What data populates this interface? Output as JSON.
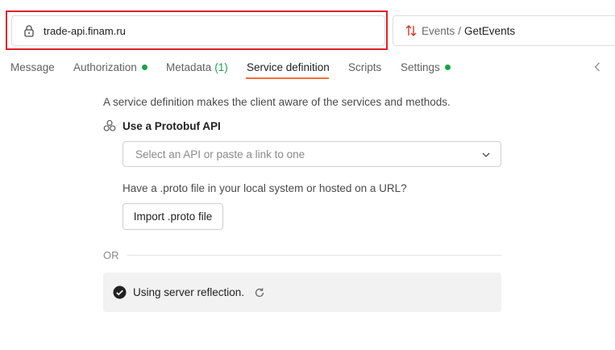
{
  "url_bar": {
    "url": "trade-api.finam.ru",
    "lock_icon": "lock-icon"
  },
  "method": {
    "icon": "bidirectional-stream-icon",
    "service": "Events",
    "separator": "/",
    "method_name": "GetEvents"
  },
  "tabs": [
    {
      "label": "Message"
    },
    {
      "label": "Authorization",
      "status_color": "#1aa34a"
    },
    {
      "label": "Metadata",
      "count": "(1)"
    },
    {
      "label": "Service definition",
      "active": true
    },
    {
      "label": "Scripts"
    },
    {
      "label": "Settings",
      "status_color": "#1aa34a"
    }
  ],
  "service_definition": {
    "description": "A service definition makes the client aware of the services and methods.",
    "protobuf_heading": "Use a Protobuf API",
    "select_placeholder": "Select an API or paste a link to one",
    "local_question": "Have a .proto file in your local system or hosted on a URL?",
    "import_button": "Import .proto file",
    "or_label": "OR",
    "reflection_label": "Using server reflection."
  },
  "colors": {
    "accent": "#ff6c37",
    "highlight_outline": "#e0202a",
    "status_green": "#1aa34a"
  }
}
